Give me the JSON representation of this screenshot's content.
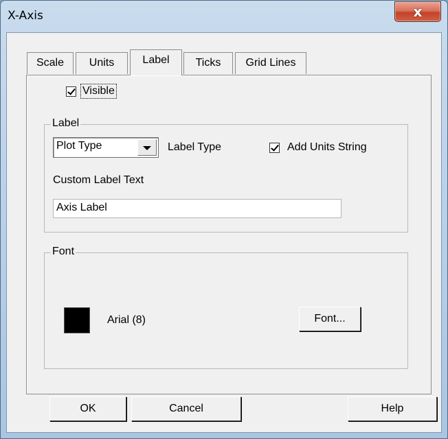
{
  "window": {
    "title": "X-Axis",
    "close_glyph": "x"
  },
  "tabs": [
    {
      "label": "Scale",
      "active": false
    },
    {
      "label": "Units",
      "active": false
    },
    {
      "label": "Label",
      "active": true
    },
    {
      "label": "Ticks",
      "active": false
    },
    {
      "label": "Grid Lines",
      "active": false
    }
  ],
  "visible": {
    "label": "Visible",
    "checked": true
  },
  "label_group": {
    "legend": "Label",
    "plot_type_value": "Plot Type",
    "label_type_caption": "Label Type",
    "add_units": {
      "label": "Add Units String",
      "checked": true
    },
    "custom_text_caption": "Custom Label Text",
    "custom_text_value": "Axis Label"
  },
  "font_group": {
    "legend": "Font",
    "font_desc": "Arial (8)",
    "font_button": "Font...",
    "swatch_color": "#000000"
  },
  "buttons": {
    "ok": "OK",
    "cancel": "Cancel",
    "help": "Help"
  }
}
